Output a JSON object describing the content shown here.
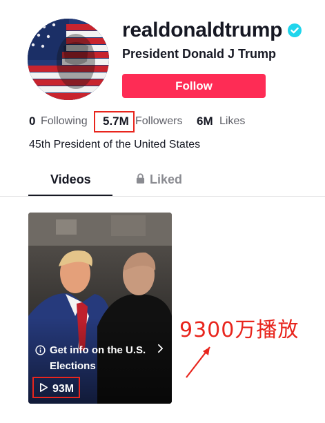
{
  "profile": {
    "username": "realdonaldtrump",
    "display_name": "President Donald J Trump",
    "bio": "45th President of the United States",
    "follow_label": "Follow",
    "avatar_icon": "flag-portrait-avatar",
    "verified_icon": "verified-badge-icon"
  },
  "stats": {
    "following_count": "0",
    "following_label": "Following",
    "followers_count": "5.7M",
    "followers_label": "Followers",
    "likes_count": "6M",
    "likes_label": "Likes"
  },
  "tabs": [
    {
      "label": "Videos",
      "active": true
    },
    {
      "label": "Liked",
      "active": false,
      "icon": "lock-icon"
    }
  ],
  "videos": [
    {
      "info_text": "Get info on the U.S. Elections",
      "views": "93M",
      "info_icon": "info-icon",
      "play_icon": "play-icon"
    }
  ],
  "annotation": {
    "text": "9300万播放",
    "color": "#e8251d"
  },
  "colors": {
    "accent": "#fe2c55",
    "verified": "#20d5ec",
    "highlight": "#e8251d"
  }
}
